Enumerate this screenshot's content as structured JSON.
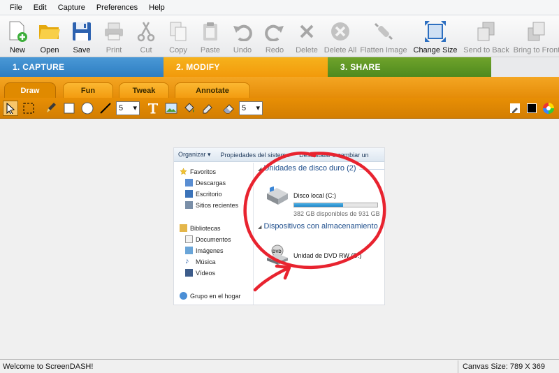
{
  "menu": [
    "File",
    "Edit",
    "Capture",
    "Preferences",
    "Help"
  ],
  "toolbar": {
    "new": "New",
    "open": "Open",
    "save": "Save",
    "print": "Print",
    "cut": "Cut",
    "copy": "Copy",
    "paste": "Paste",
    "undo": "Undo",
    "redo": "Redo",
    "delete": "Delete",
    "delete_all": "Delete All",
    "flatten": "Flatten Image",
    "change_size": "Change Size",
    "send_back": "Send to Back",
    "bring_front": "Bring to Front"
  },
  "steps": {
    "capture": "1.  CAPTURE",
    "modify": "2.  MODIFY",
    "share": "3.  SHARE"
  },
  "tabs": {
    "draw": "Draw",
    "fun": "Fun",
    "tweak": "Tweak",
    "annotate": "Annotate"
  },
  "drawbar": {
    "line_width": "5",
    "eraser_width": "5"
  },
  "screenshot": {
    "toolbar": [
      "Organizar ▾",
      "Propiedades del sistema",
      "Desinstalar o cambiar un"
    ],
    "nav": {
      "favoritos": "Favoritos",
      "descargas": "Descargas",
      "escritorio": "Escritorio",
      "sitios": "Sitios recientes",
      "bibliotecas": "Bibliotecas",
      "documentos": "Documentos",
      "imagenes": "Imágenes",
      "musica": "Música",
      "videos": "Vídeos",
      "grupo": "Grupo en el hogar"
    },
    "group_hdd": "Unidades de disco duro (2)",
    "disk_name": "Disco local (C:)",
    "disk_usage": 0.59,
    "disk_free": "382 GB disponibles de 931 GB",
    "group_removable": "Dispositivos con almacenamiento",
    "dvd_name": "Unidad de DVD RW (D:)"
  },
  "status": {
    "welcome": "Welcome to ScreenDASH!",
    "canvas_size": "Canvas Size: 789 X 369"
  },
  "colors": {
    "capture": "#2e7ec2",
    "modify": "#f29a0b",
    "share": "#4f8a1e",
    "annotation": "#e8232f"
  }
}
